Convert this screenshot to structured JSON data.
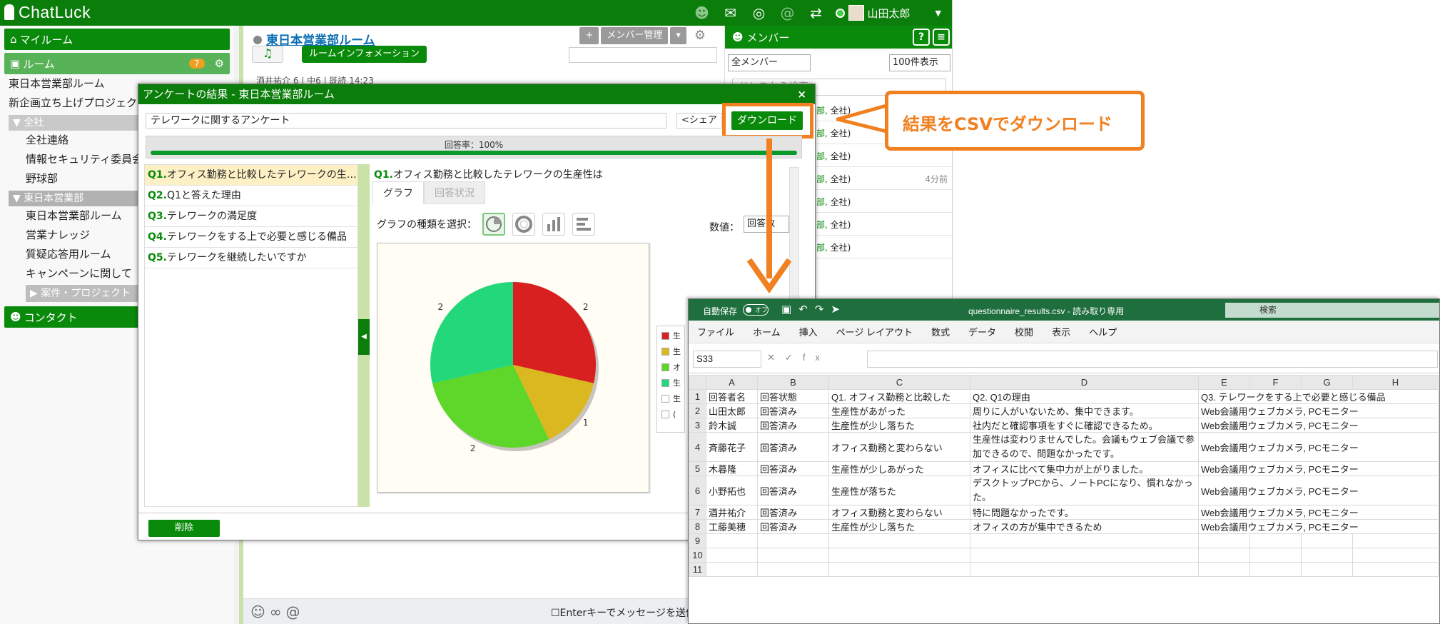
{
  "app": {
    "brand": "ChatLuck",
    "user_name": "山田太郎",
    "top_icons": [
      "person-icon",
      "chat-icon",
      "globe-icon",
      "at-icon",
      "swap-icon"
    ]
  },
  "sidebar": {
    "my_room": "マイルーム",
    "room_header": "ルーム",
    "room_badge": "7",
    "rooms": [
      "東日本営業部ルーム",
      "新企画立ち上げプロジェクト"
    ],
    "group1": "全社",
    "group1_items": [
      "全社連絡",
      "情報セキュリティ委員会",
      "野球部"
    ],
    "group2": "東日本営業部",
    "group2_items": [
      "東日本営業部ルーム",
      "営業ナレッジ",
      "質疑応答用ルーム",
      "キャンペーンに関して"
    ],
    "folder": "案件・プロジェクト",
    "contact": "コンタクト"
  },
  "center": {
    "room_title": "東日本営業部ルーム",
    "room_info": "ルームインフォメーション",
    "member_admin": "メンバー管理",
    "chat_snippet": "酒井祐介 6 | 中6 | 既読 14:23",
    "enter_label": "Enterキーでメッセージを送信",
    "send_label": "送"
  },
  "members": {
    "header": "メンバー",
    "filter": "全メンバー",
    "per_page": "100件表示",
    "search_placeholder": "ドレスから検索",
    "rows": [
      {
        "dept": "日本営業部",
        "org": "全社)",
        "ago": ""
      },
      {
        "dept": "日本営業部",
        "org": "全社)",
        "ago": ""
      },
      {
        "dept": "日本営業部",
        "org": "全社)",
        "ago": ""
      },
      {
        "dept": "日本営業部",
        "org": "全社)",
        "ago": "4分前"
      },
      {
        "dept": "日本営業部",
        "org": "全社)",
        "ago": ""
      },
      {
        "dept": "日本営業部",
        "org": "全社)",
        "ago": ""
      },
      {
        "dept": "日本営業部",
        "org": "全社)",
        "ago": ""
      }
    ]
  },
  "modal": {
    "title": "アンケートの結果 - 東日本営業部ルーム",
    "close": "×",
    "survey_name": "テレワークに関するアンケート",
    "share": "シェア",
    "download": "ダウンロード",
    "response_rate_label": "回答率：100%",
    "response_rate": 1.0,
    "questions": [
      {
        "num": "Q1.",
        "text": "オフィス勤務と比較したテレワークの生…"
      },
      {
        "num": "Q2.",
        "text": "Q1と答えた理由"
      },
      {
        "num": "Q3.",
        "text": "テレワークの満足度"
      },
      {
        "num": "Q4.",
        "text": "テレワークをする上で必要と感じる備品"
      },
      {
        "num": "Q5.",
        "text": "テレワークを継続したいですか"
      }
    ],
    "detail_num": "Q1.",
    "detail_title": "オフィス勤務と比較したテレワークの生産性は",
    "tab_graph": "グラフ",
    "tab_status": "回答状況",
    "graph_type_label": "グラフの種類を選択：",
    "value_label": "数値：",
    "value_select": "回答数",
    "delete": "削除",
    "legend_items": [
      {
        "label": "生",
        "color": "#d82020"
      },
      {
        "label": "生",
        "color": "#dbb820"
      },
      {
        "label": "オ",
        "color": "#5fd62a"
      },
      {
        "label": "生",
        "color": "#22d87a"
      },
      {
        "label": "生",
        "color": "#ffffff"
      },
      {
        "label": "(",
        "color": "#ffffff"
      }
    ]
  },
  "chart_data": {
    "type": "pie",
    "values": [
      2,
      1,
      2,
      2
    ],
    "colors": [
      "#d82020",
      "#dbb820",
      "#5fd62a",
      "#22d87a"
    ],
    "labels": [
      "2",
      "1",
      "2",
      "2"
    ]
  },
  "callout": {
    "text": "結果をCSVでダウンロード"
  },
  "excel": {
    "autosave": "自動保存",
    "toggle": "オフ",
    "filename": "questionnaire_results.csv - 読み取り専用",
    "search": "検索",
    "menu": [
      "ファイル",
      "ホーム",
      "挿入",
      "ページ レイアウト",
      "数式",
      "データ",
      "校閲",
      "表示",
      "ヘルプ"
    ],
    "name_box": "S33",
    "columns": [
      "A",
      "B",
      "C",
      "D",
      "E",
      "F",
      "G",
      "H"
    ],
    "rows": [
      [
        "回答者名",
        "回答状態",
        "Q1. オフィス勤務と比較した",
        "Q2. Q1の理由",
        "Q3. テレワークをする上で必要と感じる備品"
      ],
      [
        "山田太郎",
        "回答済み",
        "生産性があがった",
        "周りに人がいないため、集中できます。",
        "Web会議用ウェブカメラ, PCモニター"
      ],
      [
        "鈴木誠",
        "回答済み",
        "生産性が少し落ちた",
        "社内だと確認事項をすぐに確認できるため。",
        "Web会議用ウェブカメラ, PCモニター"
      ],
      [
        "斉藤花子",
        "回答済み",
        "オフィス勤務と変わらない",
        "生産性は変わりませんでした。会議もウェブ会議で参加できるので、問題なかったです。",
        "Web会議用ウェブカメラ, PCモニター"
      ],
      [
        "木暮隆",
        "回答済み",
        "生産性が少しあがった",
        "オフィスに比べて集中力が上がりました。",
        "Web会議用ウェブカメラ, PCモニター"
      ],
      [
        "小野拓也",
        "回答済み",
        "生産性が落ちた",
        "デスクトップPCから、ノートPCになり、慣れなかった。",
        "Web会議用ウェブカメラ, PCモニター"
      ],
      [
        "酒井祐介",
        "回答済み",
        "オフィス勤務と変わらない",
        "特に問題なかったです。",
        "Web会議用ウェブカメラ, PCモニター"
      ],
      [
        "工藤美穂",
        "回答済み",
        "生産性が少し落ちた",
        "オフィスの方が集中できるため",
        "Web会議用ウェブカメラ, PCモニター"
      ]
    ]
  }
}
